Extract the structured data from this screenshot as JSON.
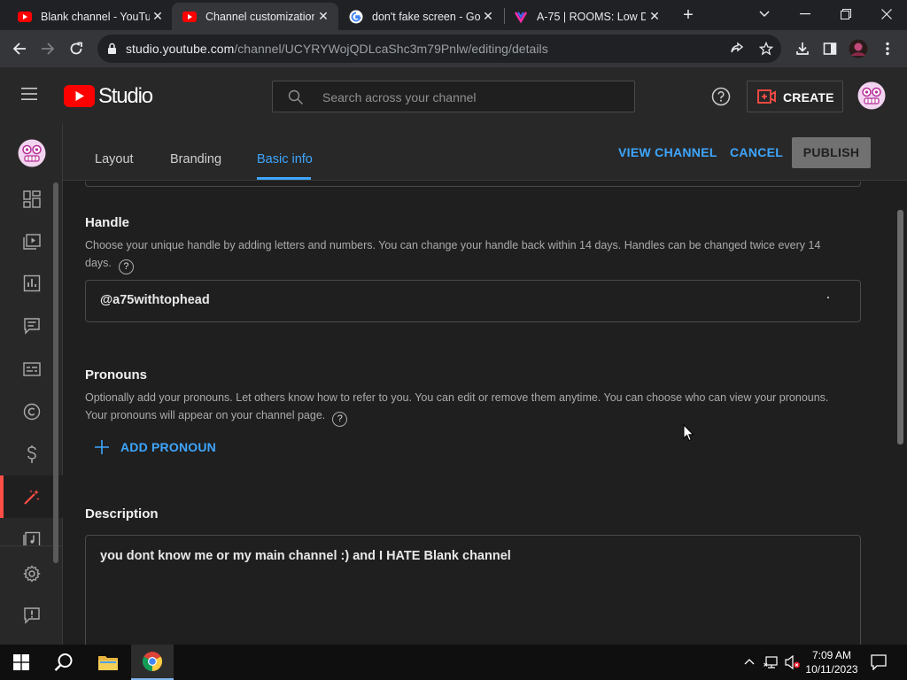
{
  "browser": {
    "tabs": [
      {
        "title": "Blank channel - YouTub",
        "icon": "youtube-icon"
      },
      {
        "title": "Channel customization",
        "icon": "youtube-studio-icon",
        "active": true
      },
      {
        "title": "don't fake screen - Goo",
        "icon": "google-icon"
      },
      {
        "title": "A-75 | ROOMS: Low De",
        "icon": "rooms-game-icon"
      }
    ],
    "url_host": "studio.youtube.com",
    "url_path": "/channel/UCYRYWojQDLcaShc3m79Pnlw/editing/details"
  },
  "studio": {
    "logo": "Studio",
    "search_placeholder": "Search across your channel",
    "create_label": "CREATE",
    "tabs": [
      "Layout",
      "Branding",
      "Basic info"
    ],
    "active_tab": "Basic info",
    "view_channel": "VIEW CHANNEL",
    "cancel": "CANCEL",
    "publish": "PUBLISH",
    "nav": [
      "dashboard-icon",
      "content-icon",
      "analytics-icon",
      "comments-icon",
      "subtitles-icon",
      "copyright-icon",
      "earn-icon",
      "customization-icon",
      "audio-library-icon",
      "settings-icon",
      "feedback-icon"
    ],
    "active_nav": "customization-icon"
  },
  "handle": {
    "title": "Handle",
    "desc_line1": "Choose your unique handle by adding letters and numbers. You can change your handle back within 14 days. Handles can be changed twice every 14",
    "desc_line2": "days.",
    "value": "@a75withtophead"
  },
  "pronouns": {
    "title": "Pronouns",
    "desc_line1": "Optionally add your pronouns. Let others know how to refer to you. You can edit or remove them anytime. You can choose who can view your pronouns.",
    "desc_line2": "Your pronouns will appear on your channel page.",
    "add_label": "ADD PRONOUN"
  },
  "description": {
    "title": "Description",
    "value": "you dont know me or my main channel :) and I HATE Blank channel"
  },
  "help_glyph": "?",
  "taskbar": {
    "time": "7:09 AM",
    "date": "10/11/2023"
  },
  "colors": {
    "accent_blue": "#3ea6ff",
    "youtube_red": "#ff0000",
    "active_nav_bar": "#ff4e45"
  }
}
